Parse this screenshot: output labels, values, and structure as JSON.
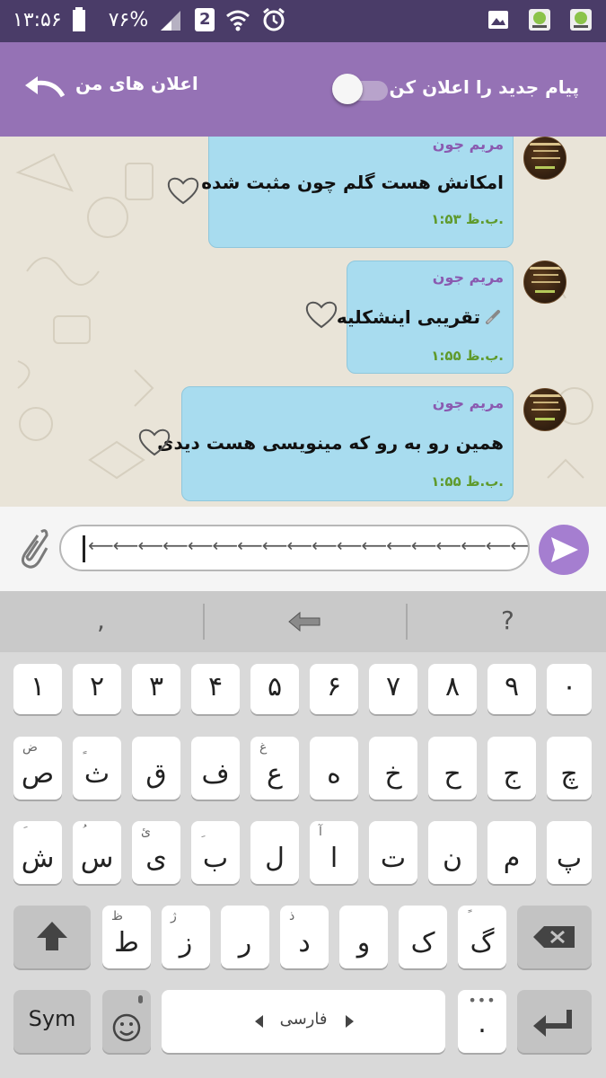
{
  "status_bar": {
    "time": "۱۳:۵۶",
    "battery": "۷۶%",
    "sim_number": "2"
  },
  "header": {
    "title": "اعلان های من",
    "toggle_label": "پیام جدید را اعلان کن"
  },
  "messages": [
    {
      "sender": "مریم جون",
      "text": "امکانش هست گلم چون مثبت شده",
      "time": "۱:۵۳ ب.ظ."
    },
    {
      "sender": "مریم جون",
      "text": "تقریبی اینشکلیه",
      "time": "۱:۵۵ ب.ظ."
    },
    {
      "sender": "مریم جون",
      "text": "همین رو به رو که مینویسی هست دیدی",
      "time": "۱:۵۵ ب.ظ."
    }
  ],
  "composer": {
    "value": "⟵⟵⟵⟵⟵⟵⟵⟵⟵⟵⟵⟵⟵⟵⟵⟵⟵⟵"
  },
  "suggestions": {
    "left": ",",
    "right": "?"
  },
  "keyboard": {
    "row1": [
      "۱",
      "۲",
      "۳",
      "۴",
      "۵",
      "۶",
      "۷",
      "۸",
      "۹",
      "۰"
    ],
    "row2": [
      {
        "k": "ص",
        "s": "ض"
      },
      {
        "k": "ث",
        "s": "ٍ"
      },
      {
        "k": "ق",
        "s": ""
      },
      {
        "k": "ف",
        "s": ""
      },
      {
        "k": "ع",
        "s": "غ"
      },
      {
        "k": "ه",
        "s": ""
      },
      {
        "k": "خ",
        "s": ""
      },
      {
        "k": "ح",
        "s": ""
      },
      {
        "k": "ج",
        "s": ""
      },
      {
        "k": "چ",
        "s": ""
      }
    ],
    "row3": [
      {
        "k": "ش",
        "s": "َ"
      },
      {
        "k": "س",
        "s": "ُ"
      },
      {
        "k": "ی",
        "s": "ئ"
      },
      {
        "k": "ب",
        "s": "ِ"
      },
      {
        "k": "ل",
        "s": ""
      },
      {
        "k": "ا",
        "s": "آ"
      },
      {
        "k": "ت",
        "s": ""
      },
      {
        "k": "ن",
        "s": ""
      },
      {
        "k": "م",
        "s": ""
      },
      {
        "k": "پ",
        "s": ""
      }
    ],
    "row4": [
      {
        "k": "ط",
        "s": "ظ"
      },
      {
        "k": "ز",
        "s": "ژ"
      },
      {
        "k": "ر",
        "s": ""
      },
      {
        "k": "د",
        "s": "ذ"
      },
      {
        "k": "و",
        "s": ""
      },
      {
        "k": "ک",
        "s": ""
      },
      {
        "k": "گ",
        "s": "ً"
      }
    ],
    "sym_label": "Sym",
    "space_label": "فارسی",
    "period": "."
  }
}
